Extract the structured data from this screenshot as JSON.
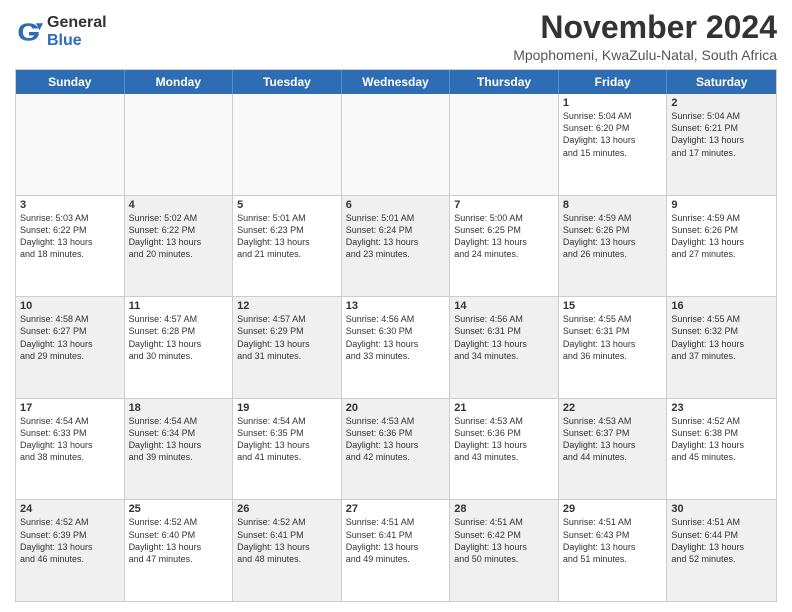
{
  "logo": {
    "general": "General",
    "blue": "Blue"
  },
  "title": "November 2024",
  "subtitle": "Mpophomeni, KwaZulu-Natal, South Africa",
  "headers": [
    "Sunday",
    "Monday",
    "Tuesday",
    "Wednesday",
    "Thursday",
    "Friday",
    "Saturday"
  ],
  "rows": [
    [
      {
        "day": "",
        "info": "",
        "empty": true
      },
      {
        "day": "",
        "info": "",
        "empty": true
      },
      {
        "day": "",
        "info": "",
        "empty": true
      },
      {
        "day": "",
        "info": "",
        "empty": true
      },
      {
        "day": "",
        "info": "",
        "empty": true
      },
      {
        "day": "1",
        "info": "Sunrise: 5:04 AM\nSunset: 6:20 PM\nDaylight: 13 hours\nand 15 minutes.",
        "empty": false,
        "shaded": false
      },
      {
        "day": "2",
        "info": "Sunrise: 5:04 AM\nSunset: 6:21 PM\nDaylight: 13 hours\nand 17 minutes.",
        "empty": false,
        "shaded": true
      }
    ],
    [
      {
        "day": "3",
        "info": "Sunrise: 5:03 AM\nSunset: 6:22 PM\nDaylight: 13 hours\nand 18 minutes.",
        "empty": false,
        "shaded": false
      },
      {
        "day": "4",
        "info": "Sunrise: 5:02 AM\nSunset: 6:22 PM\nDaylight: 13 hours\nand 20 minutes.",
        "empty": false,
        "shaded": true
      },
      {
        "day": "5",
        "info": "Sunrise: 5:01 AM\nSunset: 6:23 PM\nDaylight: 13 hours\nand 21 minutes.",
        "empty": false,
        "shaded": false
      },
      {
        "day": "6",
        "info": "Sunrise: 5:01 AM\nSunset: 6:24 PM\nDaylight: 13 hours\nand 23 minutes.",
        "empty": false,
        "shaded": true
      },
      {
        "day": "7",
        "info": "Sunrise: 5:00 AM\nSunset: 6:25 PM\nDaylight: 13 hours\nand 24 minutes.",
        "empty": false,
        "shaded": false
      },
      {
        "day": "8",
        "info": "Sunrise: 4:59 AM\nSunset: 6:26 PM\nDaylight: 13 hours\nand 26 minutes.",
        "empty": false,
        "shaded": true
      },
      {
        "day": "9",
        "info": "Sunrise: 4:59 AM\nSunset: 6:26 PM\nDaylight: 13 hours\nand 27 minutes.",
        "empty": false,
        "shaded": false
      }
    ],
    [
      {
        "day": "10",
        "info": "Sunrise: 4:58 AM\nSunset: 6:27 PM\nDaylight: 13 hours\nand 29 minutes.",
        "empty": false,
        "shaded": true
      },
      {
        "day": "11",
        "info": "Sunrise: 4:57 AM\nSunset: 6:28 PM\nDaylight: 13 hours\nand 30 minutes.",
        "empty": false,
        "shaded": false
      },
      {
        "day": "12",
        "info": "Sunrise: 4:57 AM\nSunset: 6:29 PM\nDaylight: 13 hours\nand 31 minutes.",
        "empty": false,
        "shaded": true
      },
      {
        "day": "13",
        "info": "Sunrise: 4:56 AM\nSunset: 6:30 PM\nDaylight: 13 hours\nand 33 minutes.",
        "empty": false,
        "shaded": false
      },
      {
        "day": "14",
        "info": "Sunrise: 4:56 AM\nSunset: 6:31 PM\nDaylight: 13 hours\nand 34 minutes.",
        "empty": false,
        "shaded": true
      },
      {
        "day": "15",
        "info": "Sunrise: 4:55 AM\nSunset: 6:31 PM\nDaylight: 13 hours\nand 36 minutes.",
        "empty": false,
        "shaded": false
      },
      {
        "day": "16",
        "info": "Sunrise: 4:55 AM\nSunset: 6:32 PM\nDaylight: 13 hours\nand 37 minutes.",
        "empty": false,
        "shaded": true
      }
    ],
    [
      {
        "day": "17",
        "info": "Sunrise: 4:54 AM\nSunset: 6:33 PM\nDaylight: 13 hours\nand 38 minutes.",
        "empty": false,
        "shaded": false
      },
      {
        "day": "18",
        "info": "Sunrise: 4:54 AM\nSunset: 6:34 PM\nDaylight: 13 hours\nand 39 minutes.",
        "empty": false,
        "shaded": true
      },
      {
        "day": "19",
        "info": "Sunrise: 4:54 AM\nSunset: 6:35 PM\nDaylight: 13 hours\nand 41 minutes.",
        "empty": false,
        "shaded": false
      },
      {
        "day": "20",
        "info": "Sunrise: 4:53 AM\nSunset: 6:36 PM\nDaylight: 13 hours\nand 42 minutes.",
        "empty": false,
        "shaded": true
      },
      {
        "day": "21",
        "info": "Sunrise: 4:53 AM\nSunset: 6:36 PM\nDaylight: 13 hours\nand 43 minutes.",
        "empty": false,
        "shaded": false
      },
      {
        "day": "22",
        "info": "Sunrise: 4:53 AM\nSunset: 6:37 PM\nDaylight: 13 hours\nand 44 minutes.",
        "empty": false,
        "shaded": true
      },
      {
        "day": "23",
        "info": "Sunrise: 4:52 AM\nSunset: 6:38 PM\nDaylight: 13 hours\nand 45 minutes.",
        "empty": false,
        "shaded": false
      }
    ],
    [
      {
        "day": "24",
        "info": "Sunrise: 4:52 AM\nSunset: 6:39 PM\nDaylight: 13 hours\nand 46 minutes.",
        "empty": false,
        "shaded": true
      },
      {
        "day": "25",
        "info": "Sunrise: 4:52 AM\nSunset: 6:40 PM\nDaylight: 13 hours\nand 47 minutes.",
        "empty": false,
        "shaded": false
      },
      {
        "day": "26",
        "info": "Sunrise: 4:52 AM\nSunset: 6:41 PM\nDaylight: 13 hours\nand 48 minutes.",
        "empty": false,
        "shaded": true
      },
      {
        "day": "27",
        "info": "Sunrise: 4:51 AM\nSunset: 6:41 PM\nDaylight: 13 hours\nand 49 minutes.",
        "empty": false,
        "shaded": false
      },
      {
        "day": "28",
        "info": "Sunrise: 4:51 AM\nSunset: 6:42 PM\nDaylight: 13 hours\nand 50 minutes.",
        "empty": false,
        "shaded": true
      },
      {
        "day": "29",
        "info": "Sunrise: 4:51 AM\nSunset: 6:43 PM\nDaylight: 13 hours\nand 51 minutes.",
        "empty": false,
        "shaded": false
      },
      {
        "day": "30",
        "info": "Sunrise: 4:51 AM\nSunset: 6:44 PM\nDaylight: 13 hours\nand 52 minutes.",
        "empty": false,
        "shaded": true
      }
    ]
  ]
}
